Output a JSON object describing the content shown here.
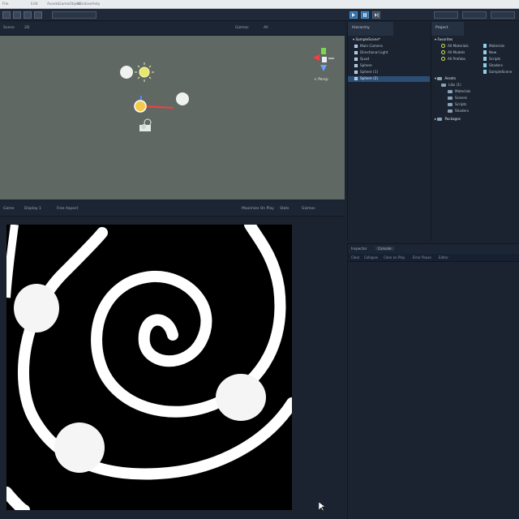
{
  "menu": {
    "app_title": "Unity Editor",
    "items": [
      "File",
      "Edit",
      "Assets",
      "GameObject",
      "Component",
      "Window",
      "Help"
    ]
  },
  "scene_tab": {
    "title": "Scene",
    "mode": "2D",
    "gizmos": "Gizmos",
    "search": "All",
    "view_label": "< Persp"
  },
  "game_tab": {
    "title": "Game",
    "display": "Display 1",
    "aspect": "Free Aspect",
    "scale": "Scale 1x",
    "maximize": "Maximize On Play",
    "stats": "Stats",
    "gizmos": "Gizmos"
  },
  "hierarchy": {
    "tab": "Hierarchy",
    "scene_name": "SampleScene*",
    "items": [
      "Main Camera",
      "Directional Light",
      "Quad",
      "Sphere",
      "Sphere (1)",
      "Sphere (2)"
    ],
    "selected_index": 5
  },
  "project": {
    "tab": "Project",
    "favorites": "Favorites",
    "favorite_items": [
      "All Materials",
      "All Models",
      "All Prefabs"
    ],
    "assets": "Assets",
    "asset_folders": [
      "Materials",
      "Scenes",
      "Scripts",
      "Shaders"
    ],
    "asset_root_child": "Libs (1)",
    "packages": "Packages",
    "file_list": [
      "Materials",
      "New",
      "Scripts",
      "Shaders",
      "SampleScene"
    ]
  },
  "inspector": {
    "tabs": [
      "Inspector",
      "Console"
    ],
    "toolbar": [
      "Clear",
      "Collapse",
      "Clear on Play",
      "Error Pause",
      "Editor"
    ]
  },
  "colors": {
    "scene_bg": "#5f6862",
    "game_bg": "#000000",
    "selection": "#2b4f74",
    "panel_bg": "#1b2330"
  },
  "icons": [
    "play-icon",
    "pause-icon",
    "step-icon",
    "scene-gizmo-icon",
    "sun-icon",
    "camera-icon",
    "cursor-icon"
  ]
}
